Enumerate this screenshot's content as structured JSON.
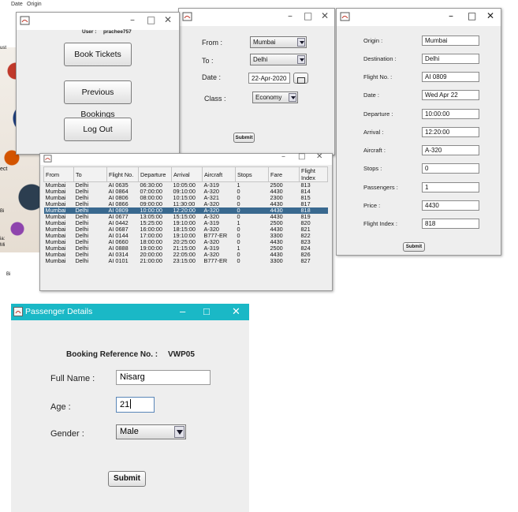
{
  "background_app": {
    "top_labels": [
      "Date",
      "Origin"
    ],
    "side_snippets": [
      "ust",
      "ect",
      "Bi",
      "ia:",
      "Mi",
      "Bi"
    ]
  },
  "menu_window": {
    "user_label": "User :",
    "user_name": "prachee757",
    "buttons": [
      "Book Tickets",
      "Previous Bookings",
      "Log Out"
    ]
  },
  "search_window": {
    "from_label": "From :",
    "from_value": "Mumbai",
    "to_label": "To :",
    "to_value": "Delhi",
    "date_label": "Date :",
    "date_value": "22-Apr-2020",
    "class_label": "Class :",
    "class_value": "Economy",
    "submit_label": "Submit"
  },
  "flights_window": {
    "columns": [
      "From",
      "To",
      "Flight No.",
      "Departure",
      "Arrival",
      "Aircraft",
      "Stops",
      "Fare",
      "Flight Index"
    ],
    "rows": [
      [
        "Mumbai",
        "Delhi",
        "AI 0635",
        "06:30:00",
        "10:05:00",
        "A-319",
        "1",
        "2500",
        "813"
      ],
      [
        "Mumbai",
        "Delhi",
        "AI 0864",
        "07:00:00",
        "09:10:00",
        "A-320",
        "0",
        "4430",
        "814"
      ],
      [
        "Mumbai",
        "Delhi",
        "AI 0806",
        "08:00:00",
        "10:15:00",
        "A-321",
        "0",
        "2300",
        "815"
      ],
      [
        "Mumbai",
        "Delhi",
        "AI 0866",
        "09:00:00",
        "11:30:00",
        "A-320",
        "0",
        "4430",
        "817"
      ],
      [
        "Mumbai",
        "Delhi",
        "AI 0809",
        "10:00:00",
        "12:20:00",
        "A-320",
        "0",
        "4430",
        "818"
      ],
      [
        "Mumbai",
        "Delhi",
        "AI 0677",
        "13:05:00",
        "15:15:00",
        "A-320",
        "0",
        "4430",
        "819"
      ],
      [
        "Mumbai",
        "Delhi",
        "AI 0442",
        "15:25:00",
        "19:10:00",
        "A-319",
        "1",
        "2500",
        "820"
      ],
      [
        "Mumbai",
        "Delhi",
        "AI 0687",
        "16:00:00",
        "18:15:00",
        "A-320",
        "0",
        "4430",
        "821"
      ],
      [
        "Mumbai",
        "Delhi",
        "AI 0144",
        "17:00:00",
        "19:10:00",
        "B777-ER",
        "0",
        "3300",
        "822"
      ],
      [
        "Mumbai",
        "Delhi",
        "AI 0660",
        "18:00:00",
        "20:25:00",
        "A-320",
        "0",
        "4430",
        "823"
      ],
      [
        "Mumbai",
        "Delhi",
        "AI 0888",
        "19:00:00",
        "21:15:00",
        "A-319",
        "1",
        "2500",
        "824"
      ],
      [
        "Mumbai",
        "Delhi",
        "AI 0314",
        "20:00:00",
        "22:05:00",
        "A-320",
        "0",
        "4430",
        "826"
      ],
      [
        "Mumbai",
        "Delhi",
        "AI 0101",
        "21:00:00",
        "23:15:00",
        "B777-ER",
        "0",
        "3300",
        "827"
      ]
    ],
    "selected_row": 4
  },
  "detail_window": {
    "fields": [
      {
        "label": "Origin :",
        "value": "Mumbai"
      },
      {
        "label": "Destination :",
        "value": "Delhi"
      },
      {
        "label": "Flight No. :",
        "value": "AI 0809"
      },
      {
        "label": "Date :",
        "value": "Wed Apr 22"
      },
      {
        "label": "Departure :",
        "value": "10:00:00"
      },
      {
        "label": "Arrival :",
        "value": "12:20:00"
      },
      {
        "label": "Aircraft :",
        "value": "A-320"
      },
      {
        "label": "Stops :",
        "value": "0"
      },
      {
        "label": "Passengers :",
        "value": "1"
      },
      {
        "label": "Price :",
        "value": "4430"
      },
      {
        "label": "Flight Index :",
        "value": "818"
      }
    ],
    "submit_label": "Submit"
  },
  "passenger_window": {
    "title": "Passenger Details",
    "booking_ref_label": "Booking Reference No. :",
    "booking_ref_value": "VWP05",
    "full_name_label": "Full Name :",
    "full_name_value": "Nisarg",
    "age_label": "Age :",
    "age_value": "21",
    "gender_label": "Gender :",
    "gender_value": "Male",
    "submit_label": "Submit"
  },
  "colors": {
    "titlebar_active": "#1ab8c6",
    "selection": "#39698f",
    "window_bg": "#eeeeee"
  },
  "icons": [
    "java-icon",
    "minimize-icon",
    "maximize-icon",
    "close-icon",
    "calendar-icon",
    "dropdown-arrow-icon"
  ]
}
